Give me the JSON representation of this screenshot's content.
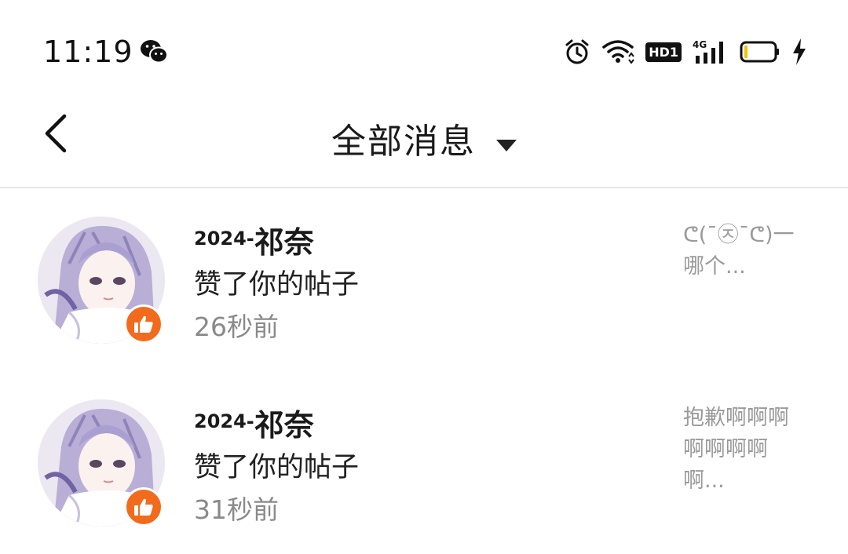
{
  "status_bar": {
    "time": "11:19",
    "hd_label": "HD1",
    "network_label": "4G",
    "icons": [
      "wechat-icon",
      "alarm-icon",
      "wifi-icon",
      "hd-icon",
      "signal-icon",
      "battery-icon",
      "charging-icon"
    ]
  },
  "header": {
    "title": "全部消息",
    "back_icon": "chevron-left-icon",
    "dropdown_icon": "caret-down-icon"
  },
  "messages": [
    {
      "user_prefix": "2024-",
      "user_suffix": "祁奈",
      "action": "赞了你的帖子",
      "time_ago": "26秒前",
      "preview": "ᕦ(¯㉨¯ᕦ)一哪个..."
    },
    {
      "user_prefix": "2024-",
      "user_suffix": "祁奈",
      "action": "赞了你的帖子",
      "time_ago": "31秒前",
      "preview": "抱歉啊啊啊啊啊啊啊啊..."
    }
  ],
  "colors": {
    "like_badge": "#f26b1d",
    "divider": "#e6e6e6",
    "secondary_text": "#8a8a8a",
    "preview_text": "#9a9a9a"
  }
}
